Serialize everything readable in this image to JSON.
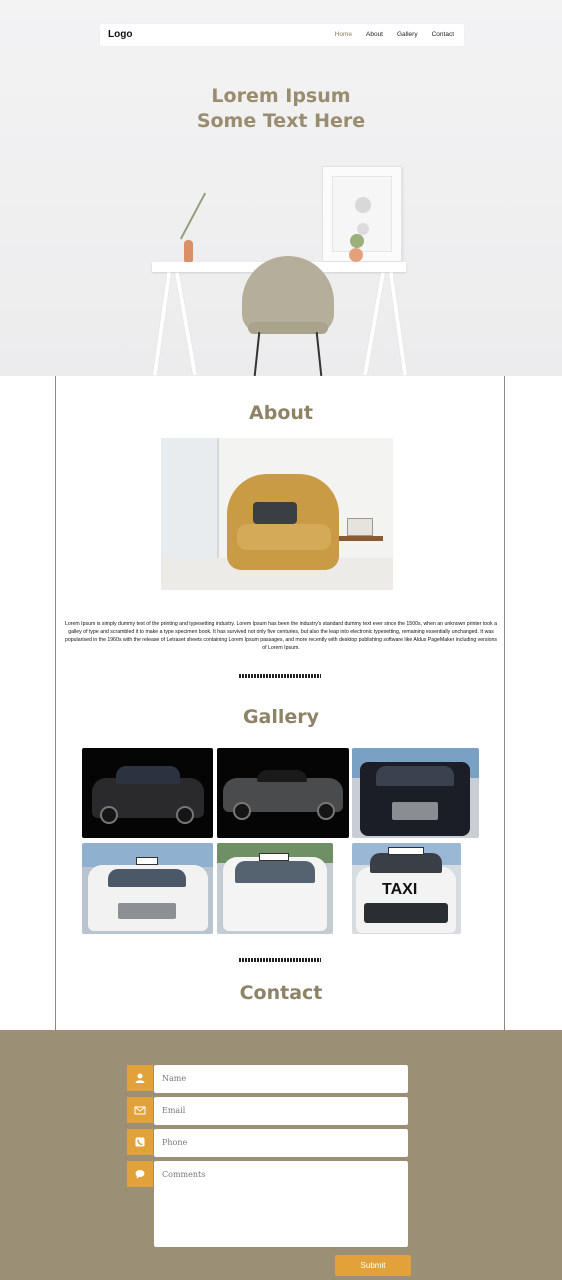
{
  "nav": {
    "logo": "Logo",
    "links": [
      "Home",
      "About",
      "Gallery",
      "Contact"
    ],
    "active_link": "Home"
  },
  "hero": {
    "line1": "Lorem Ipsum",
    "line2": "Some Text Here"
  },
  "about": {
    "title": "About",
    "text": "Lorem Ipsum is simply dummy text of the printing and typesetting industry. Lorem Ipsum has been the industry's standard dummy text ever since the 1500s, when an unknown printer took a galley of type and scrambled it to make a type specimen book. It has survived not only five centuries, but also the leap into electronic typesetting, remaining essentially unchanged. It was popularised in the 1960s with the release of Letraset sheets containing Lorem Ipsum passages, and more recently with desktop publishing software like Aldus PageMaker including versions of Lorem Ipsum."
  },
  "gallery": {
    "title": "Gallery",
    "images": [
      "black-bmw-sedan",
      "grey-mercedes-convertible",
      "black-cadillac-suv",
      "white-taxi-sedan",
      "white-minivan-taxi",
      "taxi-car"
    ],
    "taxi_label": "TAXI"
  },
  "contact": {
    "title": "Contact",
    "fields": {
      "name": "Name",
      "email": "Email",
      "phone": "Phone",
      "comments": "Comments"
    },
    "submit": "Submit"
  },
  "colors": {
    "accent": "#e1a23a",
    "heading": "#8f8367",
    "band": "#9b8f76"
  }
}
